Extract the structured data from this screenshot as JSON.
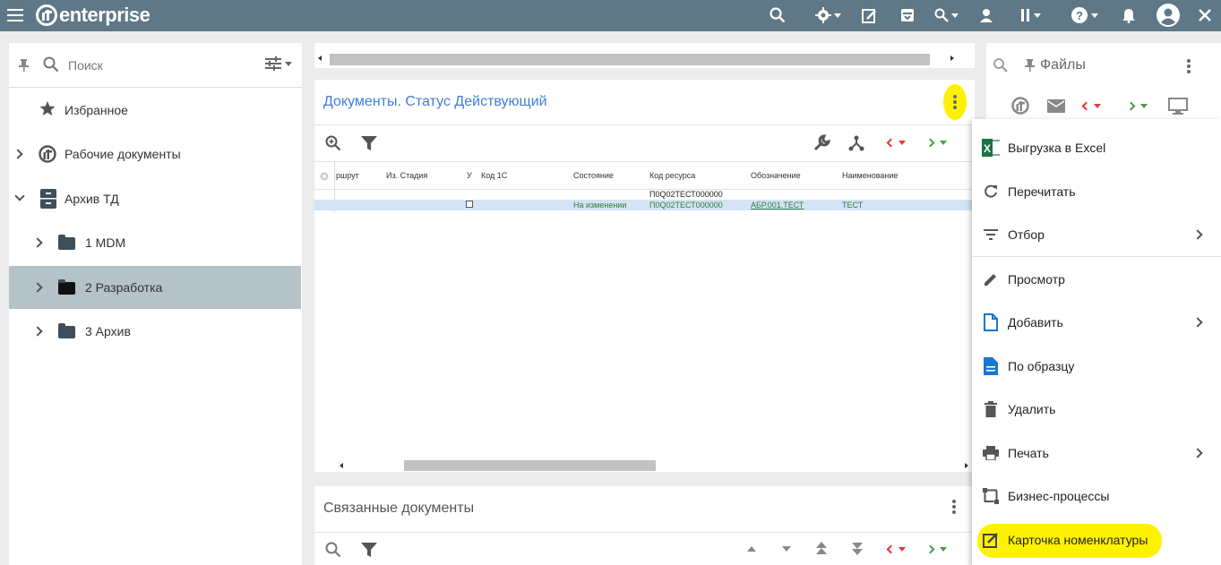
{
  "app": {
    "logo_text": "enterprise"
  },
  "colors": {
    "topbar": "#5f7887",
    "accent_blue": "#3f7fd9",
    "selected_row": "#b5c2c8",
    "highlight": "#fff200",
    "green_text": "#2e7d32"
  },
  "topbar": {
    "icons": [
      "menu-icon",
      "search-icon",
      "gear-icon",
      "edit-note-icon",
      "archive-icon",
      "search-dropdown-icon",
      "user-icon",
      "pause-icon",
      "help-icon",
      "bell-icon",
      "account-icon"
    ]
  },
  "left_panel": {
    "search_placeholder": "Поиск",
    "tree": [
      {
        "label": "Избранное",
        "icon": "star-icon"
      },
      {
        "label": "Рабочие документы",
        "icon": "logo-icon"
      },
      {
        "label": "Архив ТД",
        "icon": "cabinet-icon"
      },
      {
        "label": "1 MDM",
        "icon": "folder-icon"
      },
      {
        "label": "2 Разработка",
        "icon": "folder-icon",
        "selected": true
      },
      {
        "label": "3 Архив",
        "icon": "folder-icon"
      }
    ]
  },
  "documents_panel": {
    "title": "Документы. Статус Действующий",
    "columns": [
      "ршрут",
      "Из. Стадия",
      "У",
      "Код 1С",
      "Состояние",
      "Код ресурса",
      "Обозначение",
      "Наименование"
    ],
    "rows": [
      {
        "code_resource": "П0Q02ТЕСТ000000"
      },
      {
        "state": "На изменении",
        "code_resource": "П0Q02ТЕСТ000000",
        "designation": "АБР.001.ТЕСТ",
        "name": "ТЕСТ"
      }
    ]
  },
  "related_panel": {
    "title": "Связанные документы"
  },
  "files_panel": {
    "title": "Файлы"
  },
  "context_menu": {
    "items": [
      {
        "label": "Выгрузка в Excel",
        "icon": "excel-icon"
      },
      {
        "label": "Перечитать",
        "icon": "refresh-icon"
      },
      {
        "label": "Отбор",
        "icon": "filter-list-icon",
        "submenu": true
      },
      {
        "label": "Просмотр",
        "icon": "pencil-icon"
      },
      {
        "label": "Добавить",
        "icon": "add-file-icon",
        "submenu": true
      },
      {
        "label": "По образцу",
        "icon": "document-icon"
      },
      {
        "label": "Удалить",
        "icon": "trash-icon"
      },
      {
        "label": "Печать",
        "icon": "printer-icon",
        "submenu": true
      },
      {
        "label": "Бизнес-процессы",
        "icon": "workflow-icon"
      },
      {
        "label": "Карточка номенклатуры",
        "icon": "edit-card-icon",
        "highlighted": true
      }
    ]
  }
}
